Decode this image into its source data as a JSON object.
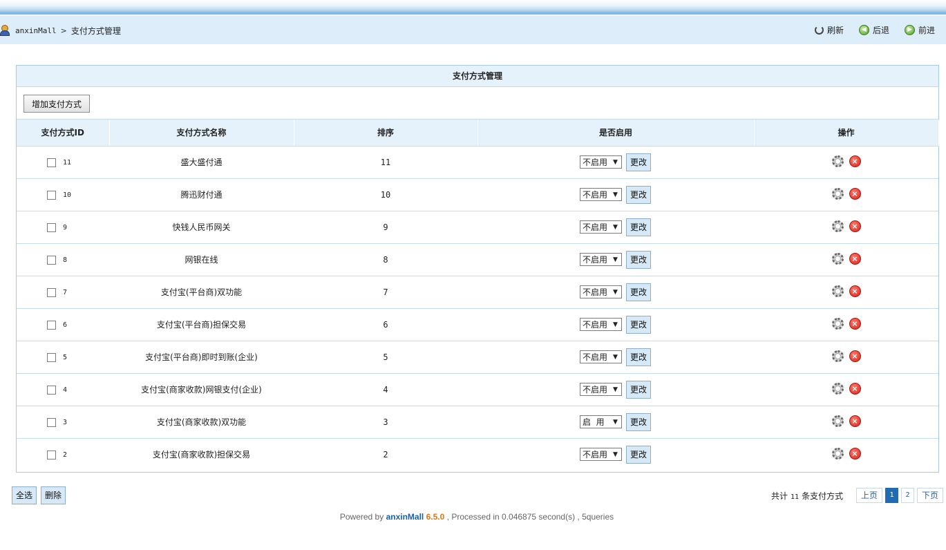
{
  "breadcrumb": {
    "root": "anxinMall",
    "separator": ">",
    "current": "支付方式管理"
  },
  "nav": {
    "refresh": "刷新",
    "back": "后退",
    "forward": "前进"
  },
  "panel": {
    "title": "支付方式管理",
    "add_button": "增加支付方式"
  },
  "table": {
    "headers": [
      "支付方式ID",
      "支付方式名称",
      "排序",
      "是否启用",
      "操作"
    ],
    "change_button": "更改",
    "rows": [
      {
        "id": "11",
        "name": "盛大盛付通",
        "sort": "11",
        "status": "不启用"
      },
      {
        "id": "10",
        "name": "腾迅财付通",
        "sort": "10",
        "status": "不启用"
      },
      {
        "id": "9",
        "name": "快钱人民币网关",
        "sort": "9",
        "status": "不启用"
      },
      {
        "id": "8",
        "name": "网银在线",
        "sort": "8",
        "status": "不启用"
      },
      {
        "id": "7",
        "name": "支付宝(平台商)双功能",
        "sort": "7",
        "status": "不启用"
      },
      {
        "id": "6",
        "name": "支付宝(平台商)担保交易",
        "sort": "6",
        "status": "不启用"
      },
      {
        "id": "5",
        "name": "支付宝(平台商)即时到账(企业)",
        "sort": "5",
        "status": "不启用"
      },
      {
        "id": "4",
        "name": "支付宝(商家收款)网银支付(企业)",
        "sort": "4",
        "status": "不启用"
      },
      {
        "id": "3",
        "name": "支付宝(商家收款)双功能",
        "sort": "3",
        "status": "启  用"
      },
      {
        "id": "2",
        "name": "支付宝(商家收款)担保交易",
        "sort": "2",
        "status": "不启用"
      }
    ]
  },
  "bottom": {
    "select_all": "全选",
    "delete": "删除",
    "total_prefix": "共计",
    "total_count": "11",
    "total_suffix": "条支付方式",
    "prev": "上页",
    "pages": [
      "1",
      "2"
    ],
    "current_page": "1",
    "next": "下页"
  },
  "footer": {
    "powered": "Powered by",
    "brand": "anxinMall",
    "version": "6.5.0",
    "processed": ", Processed in 0.046875 second(s) , 5queries"
  },
  "colors": {
    "accent": "#1f6cb4",
    "header_bg": "#e6f2fb",
    "crumb_bg": "#ddeefa",
    "delete_red": "#d8231a"
  }
}
